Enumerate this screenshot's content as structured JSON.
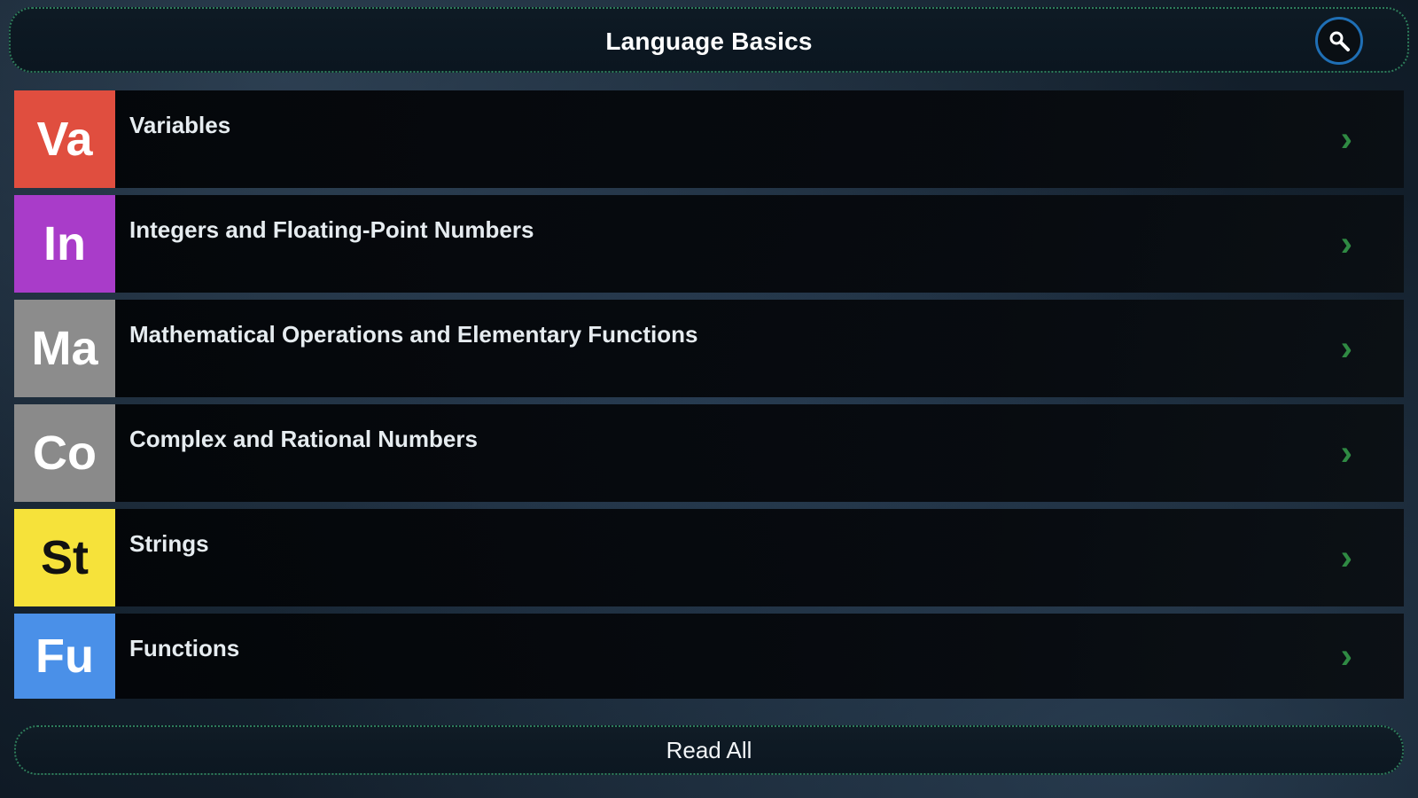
{
  "header": {
    "title": "Language Basics",
    "search_icon": "search-icon"
  },
  "topics": [
    {
      "abbr": "Va",
      "title": "Variables",
      "color": "#e04e3f",
      "text_color": "#ffffff"
    },
    {
      "abbr": "In",
      "title": "Integers and Floating-Point Numbers",
      "color": "#a93cc9",
      "text_color": "#ffffff"
    },
    {
      "abbr": "Ma",
      "title": "Mathematical Operations and Elementary Functions",
      "color": "#8c8c8c",
      "text_color": "#ffffff"
    },
    {
      "abbr": "Co",
      "title": "Complex and Rational Numbers",
      "color": "#8a8a8a",
      "text_color": "#ffffff"
    },
    {
      "abbr": "St",
      "title": "Strings",
      "color": "#f6e23a",
      "text_color": "#111111"
    },
    {
      "abbr": "Fu",
      "title": "Functions",
      "color": "#4a90e8",
      "text_color": "#ffffff"
    }
  ],
  "footer": {
    "read_all_label": "Read All"
  },
  "colors": {
    "accent_border": "#2e7d5b",
    "chevron": "#2f8a43",
    "search_ring": "#1f6fb5"
  }
}
